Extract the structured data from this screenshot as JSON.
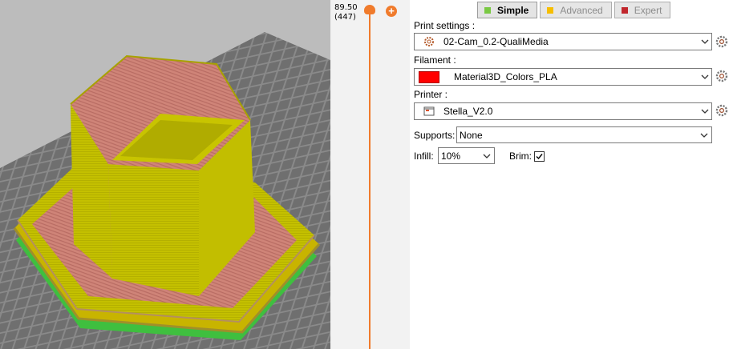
{
  "slider": {
    "height_value": "89.50",
    "layer_value": "(447)",
    "add_icon": "plus-icon"
  },
  "modes": [
    {
      "label": "Simple",
      "color": "#7ac943",
      "active": true
    },
    {
      "label": "Advanced",
      "color": "#f6be00",
      "active": false
    },
    {
      "label": "Expert",
      "color": "#c1272d",
      "active": false
    }
  ],
  "print_settings": {
    "label": "Print settings :",
    "value": "02-Cam_0.2-QualiMedia",
    "icon": "gear-cog-icon"
  },
  "filament": {
    "label": "Filament :",
    "value": "Material3D_Colors_PLA",
    "swatch_color": "#ff0000"
  },
  "printer": {
    "label": "Printer :",
    "value": "Stella_V2.0",
    "icon": "printer-icon"
  },
  "supports": {
    "label": "Supports:",
    "value": "None"
  },
  "infill": {
    "label": "Infill:",
    "value": "10%"
  },
  "brim": {
    "label": "Brim:",
    "checked": true
  },
  "colors": {
    "accent": "#f07b2c",
    "model_yellow": "#c8c400",
    "model_salmon": "#d38a7e",
    "perimeter_green": "#3fbf3f",
    "bed_gray": "#7a7a7a"
  }
}
